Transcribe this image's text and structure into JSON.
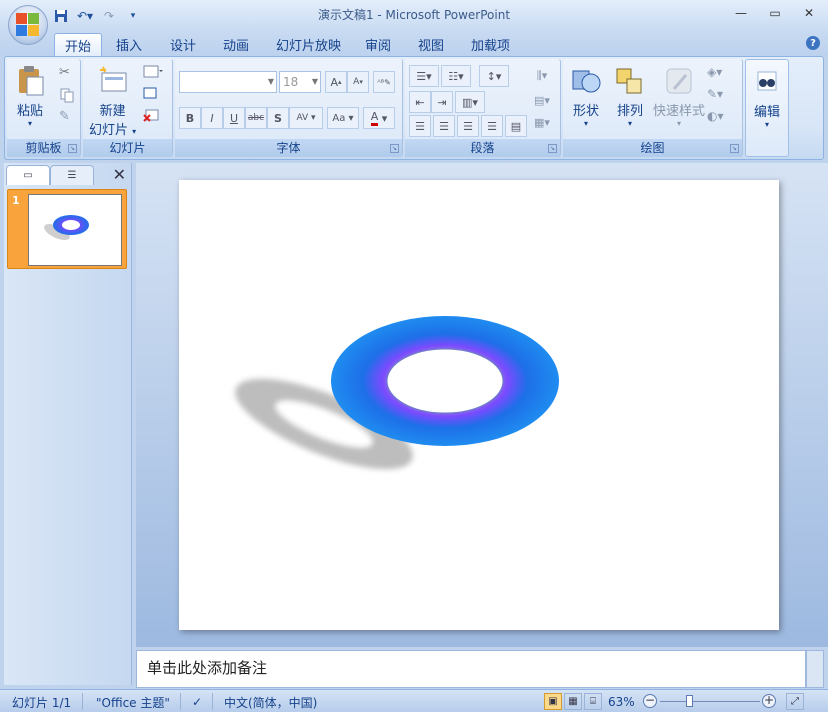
{
  "window": {
    "title": "演示文稿1 - Microsoft PowerPoint",
    "controls": [
      "minimize",
      "maximize",
      "close"
    ]
  },
  "quick_access": {
    "icons": [
      "save-icon",
      "undo-icon",
      "redo-icon",
      "customize-icon"
    ]
  },
  "tabs": [
    {
      "label": "开始",
      "active": true
    },
    {
      "label": "插入"
    },
    {
      "label": "设计"
    },
    {
      "label": "动画"
    },
    {
      "label": "幻灯片放映"
    },
    {
      "label": "审阅"
    },
    {
      "label": "视图"
    },
    {
      "label": "加载项"
    }
  ],
  "ribbon": {
    "clipboard": {
      "label": "剪贴板",
      "paste": "粘贴"
    },
    "slides": {
      "label": "幻灯片",
      "new_slide_line1": "新建",
      "new_slide_line2": "幻灯片"
    },
    "font": {
      "label": "字体",
      "font_name": "",
      "font_size": "18"
    },
    "paragraph": {
      "label": "段落"
    },
    "drawing": {
      "label": "绘图",
      "shapes": "形状",
      "arrange": "排列",
      "quick_styles": "快速样式"
    },
    "editing": {
      "label": "编辑"
    }
  },
  "slide_panel": {
    "slide_number": "1"
  },
  "notes": {
    "placeholder": "单击此处添加备注"
  },
  "statusbar": {
    "slide_info": "幻灯片 1/1",
    "theme": "\"Office 主题\"",
    "language": "中文(简体，中国)",
    "zoom": "63%"
  },
  "colors": {
    "ring_outer": "#1e6fe8",
    "ring_mid": "#7a4bff",
    "shadow": "#bdbdbd"
  }
}
